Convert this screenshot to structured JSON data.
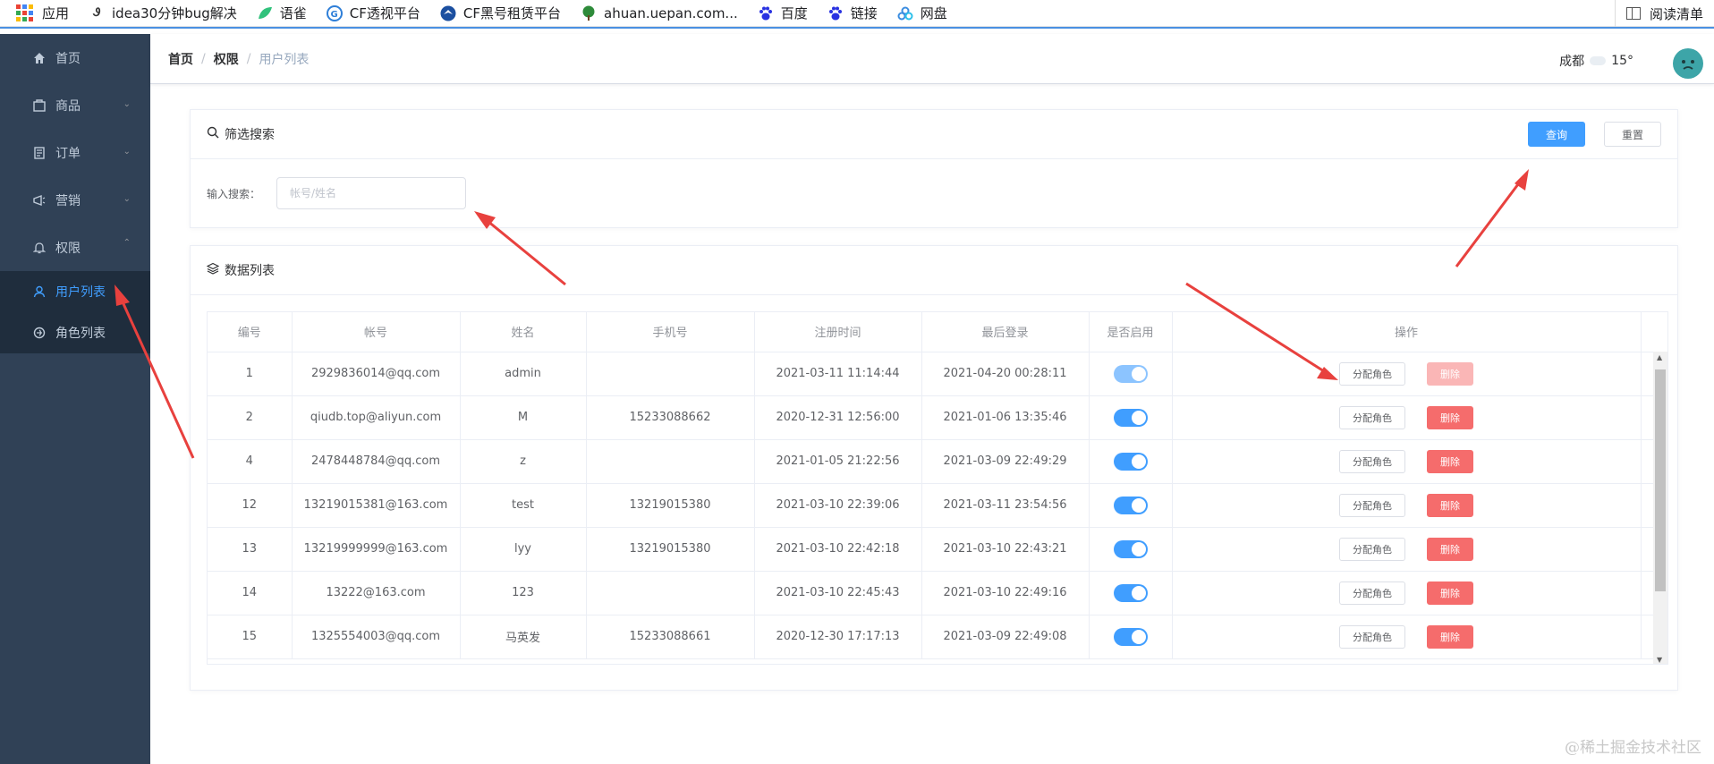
{
  "bookmarks": {
    "items": [
      {
        "label": "应用",
        "icon": "apps-grid-icon"
      },
      {
        "label": "idea30分钟bug解决",
        "icon": "idea-icon"
      },
      {
        "label": "语雀",
        "icon": "yuque-leaf-icon"
      },
      {
        "label": "CF透视平台",
        "icon": "cf-icon"
      },
      {
        "label": "CF黑号租赁平台",
        "icon": "cf-bird-icon"
      },
      {
        "label": "ahuan.uepan.com...",
        "icon": "tree-icon"
      },
      {
        "label": "百度",
        "icon": "baidu-paw-icon"
      },
      {
        "label": "链接",
        "icon": "baidu-paw-icon"
      },
      {
        "label": "网盘",
        "icon": "cloud-disk-icon"
      }
    ],
    "reading_list": "阅读清单"
  },
  "sidebar": {
    "items": [
      {
        "label": "首页",
        "icon": "home-icon"
      },
      {
        "label": "商品",
        "icon": "goods-icon"
      },
      {
        "label": "订单",
        "icon": "order-icon"
      },
      {
        "label": "营销",
        "icon": "marketing-icon"
      },
      {
        "label": "权限",
        "icon": "bell-icon"
      }
    ],
    "sub_items": [
      {
        "label": "用户列表",
        "icon": "user-icon"
      },
      {
        "label": "角色列表",
        "icon": "role-icon"
      }
    ]
  },
  "header": {
    "breadcrumb": [
      "首页",
      "权限",
      "用户列表"
    ],
    "city": "成都",
    "temperature": "15°"
  },
  "filter": {
    "title": "筛选搜索",
    "query_button": "查询",
    "reset_button": "重置",
    "search_label": "输入搜索：",
    "search_placeholder": "帐号/姓名",
    "search_value": ""
  },
  "data_list": {
    "title": "数据列表",
    "columns": [
      "编号",
      "帐号",
      "姓名",
      "手机号",
      "注册时间",
      "最后登录",
      "是否启用",
      "操作"
    ],
    "assign_role_label": "分配角色",
    "delete_label": "删除",
    "rows": [
      {
        "id": "1",
        "account": "2929836014@qq.com",
        "name": "admin",
        "phone": "",
        "registered": "2021-03-11 11:14:44",
        "last_login": "2021-04-20 00:28:11",
        "enabled": true,
        "locked": true
      },
      {
        "id": "2",
        "account": "qiudb.top@aliyun.com",
        "name": "M",
        "phone": "15233088662",
        "registered": "2020-12-31 12:56:00",
        "last_login": "2021-01-06 13:35:46",
        "enabled": true,
        "locked": false
      },
      {
        "id": "4",
        "account": "2478448784@qq.com",
        "name": "z",
        "phone": "",
        "registered": "2021-01-05 21:22:56",
        "last_login": "2021-03-09 22:49:29",
        "enabled": true,
        "locked": false
      },
      {
        "id": "12",
        "account": "13219015381@163.com",
        "name": "test",
        "phone": "13219015380",
        "registered": "2021-03-10 22:39:06",
        "last_login": "2021-03-11 23:54:56",
        "enabled": true,
        "locked": false
      },
      {
        "id": "13",
        "account": "13219999999@163.com",
        "name": "lyy",
        "phone": "13219015380",
        "registered": "2021-03-10 22:42:18",
        "last_login": "2021-03-10 22:43:21",
        "enabled": true,
        "locked": false
      },
      {
        "id": "14",
        "account": "13222@163.com",
        "name": "123",
        "phone": "",
        "registered": "2021-03-10 22:45:43",
        "last_login": "2021-03-10 22:49:16",
        "enabled": true,
        "locked": false
      },
      {
        "id": "15",
        "account": "1325554003@qq.com",
        "name": "马英发",
        "phone": "15233088661",
        "registered": "2020-12-30 17:17:13",
        "last_login": "2021-03-09 22:49:08",
        "enabled": true,
        "locked": false
      }
    ]
  },
  "colors": {
    "sidebar_bg": "#304156",
    "primary": "#409eff",
    "danger": "#f56c6c",
    "annotation_arrow": "#e8413e"
  },
  "watermark": "@稀土掘金技术社区"
}
